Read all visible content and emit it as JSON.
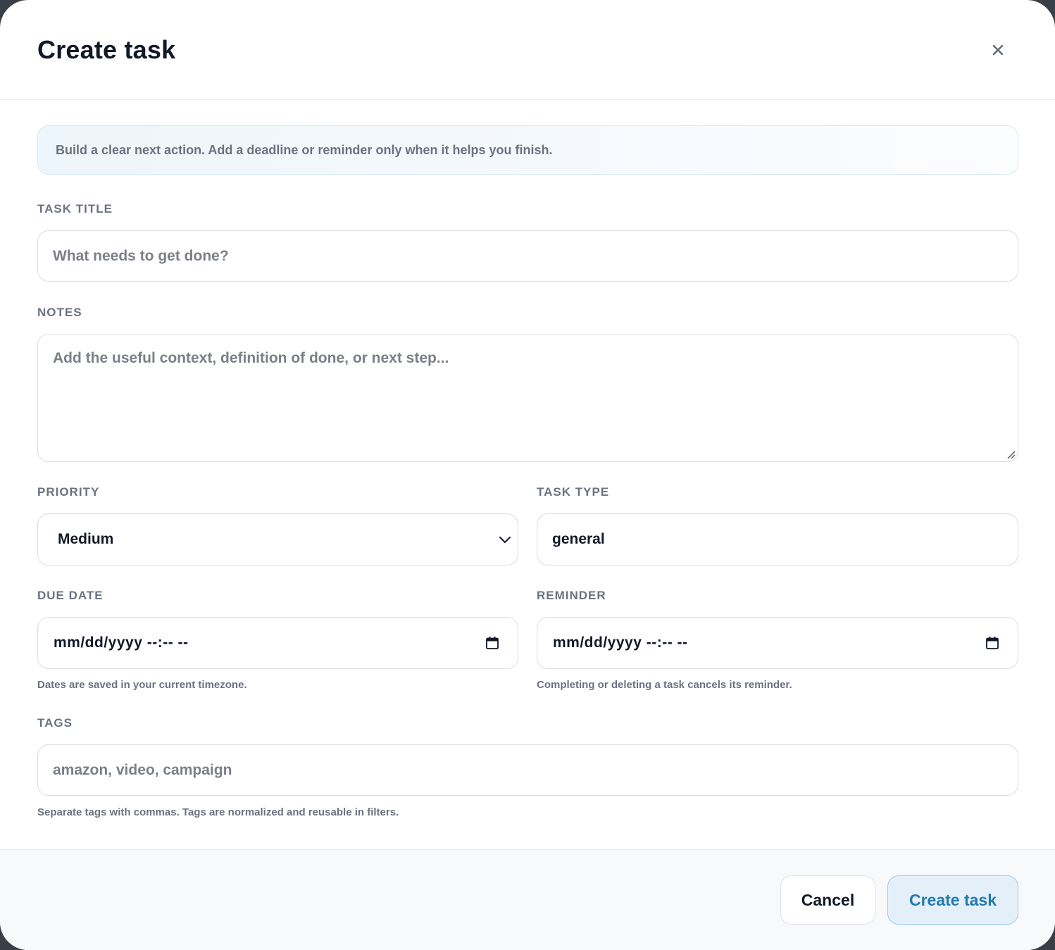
{
  "dialog": {
    "title": "Create task",
    "close_icon": "close-icon"
  },
  "info_banner": {
    "text": "Build a clear next action. Add a deadline or reminder only when it helps you finish."
  },
  "form": {
    "task_title": {
      "label": "TASK TITLE",
      "value": "",
      "placeholder": "What needs to get done?"
    },
    "notes": {
      "label": "NOTES",
      "value": "",
      "placeholder": "Add the useful context, definition of done, or next step..."
    },
    "priority": {
      "label": "PRIORITY",
      "selected": "Medium",
      "icon": "chevron-down-icon"
    },
    "task_type": {
      "label": "TASK TYPE",
      "value": "general"
    },
    "due_date": {
      "label": "DUE DATE",
      "display": "mm/dd/yyyy --:-- --",
      "hint": "Dates are saved in your current timezone.",
      "icon": "calendar-icon"
    },
    "reminder": {
      "label": "REMINDER",
      "display": "mm/dd/yyyy --:-- --",
      "hint": "Completing or deleting a task cancels its reminder.",
      "icon": "calendar-icon"
    },
    "tags": {
      "label": "TAGS",
      "value": "",
      "placeholder": "amazon, video, campaign",
      "hint": "Separate tags with commas. Tags are normalized and reusable in filters."
    }
  },
  "footer": {
    "cancel_label": "Cancel",
    "create_label": "Create task"
  },
  "colors": {
    "accent_text": "#2379ad",
    "accent_bg": "#e4f0f9",
    "accent_border": "#9fcbe8",
    "banner_bg": "#edf6fc",
    "label_text": "#6b7280",
    "title_text": "#111827"
  }
}
